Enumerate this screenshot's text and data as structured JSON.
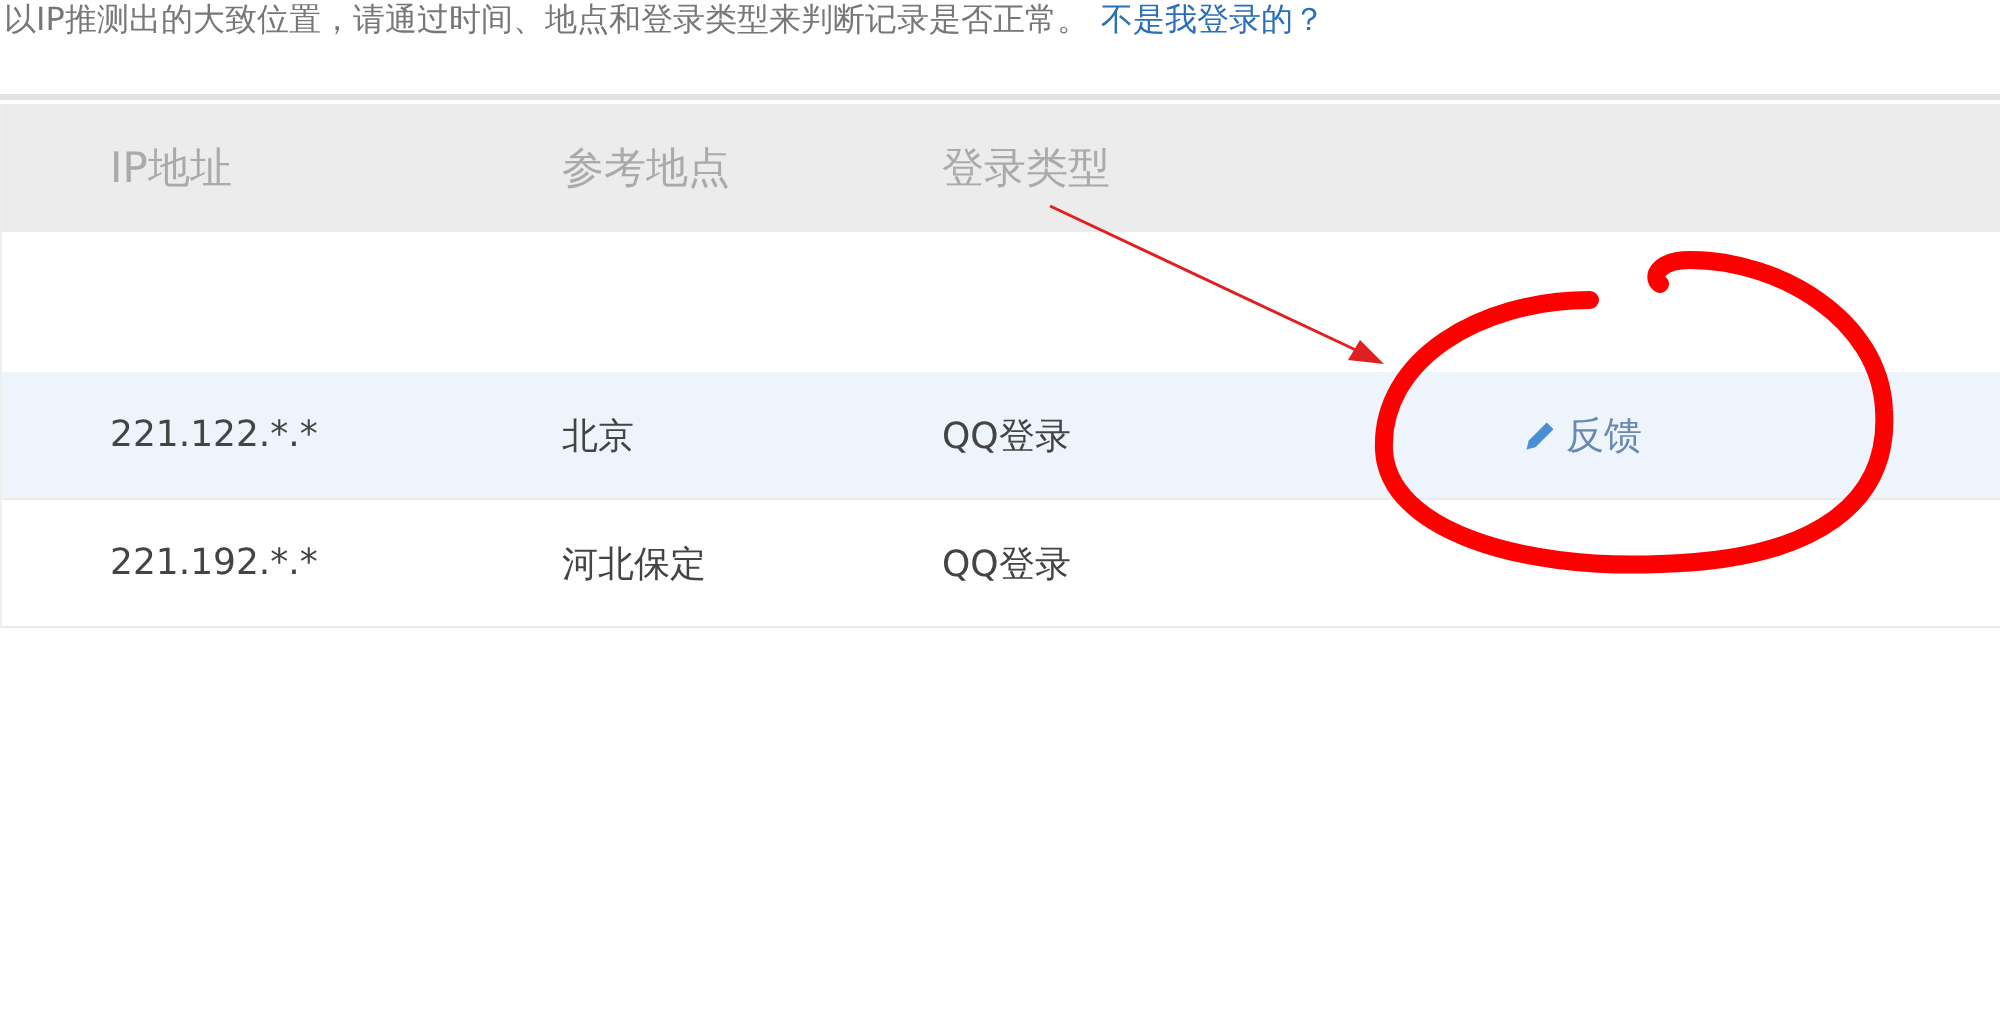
{
  "notice": {
    "text": "以IP推测出的大致位置，请通过时间、地点和登录类型来判断记录是否正常。",
    "link": "不是我登录的？"
  },
  "table": {
    "columns": [
      "IP地址",
      "参考地点",
      "登录类型"
    ],
    "rows": [
      {
        "cells": [
          "221.122.*.*",
          "北京",
          "QQ登录"
        ],
        "selected": true,
        "action": "反馈"
      },
      {
        "cells": [
          "221.192.*.*",
          "河北保定",
          "QQ登录"
        ],
        "selected": false
      }
    ]
  },
  "markup": [
    {
      "kind": "arrow",
      "color": "#e02020"
    },
    {
      "kind": "circle",
      "color": "#ff0000"
    }
  ]
}
